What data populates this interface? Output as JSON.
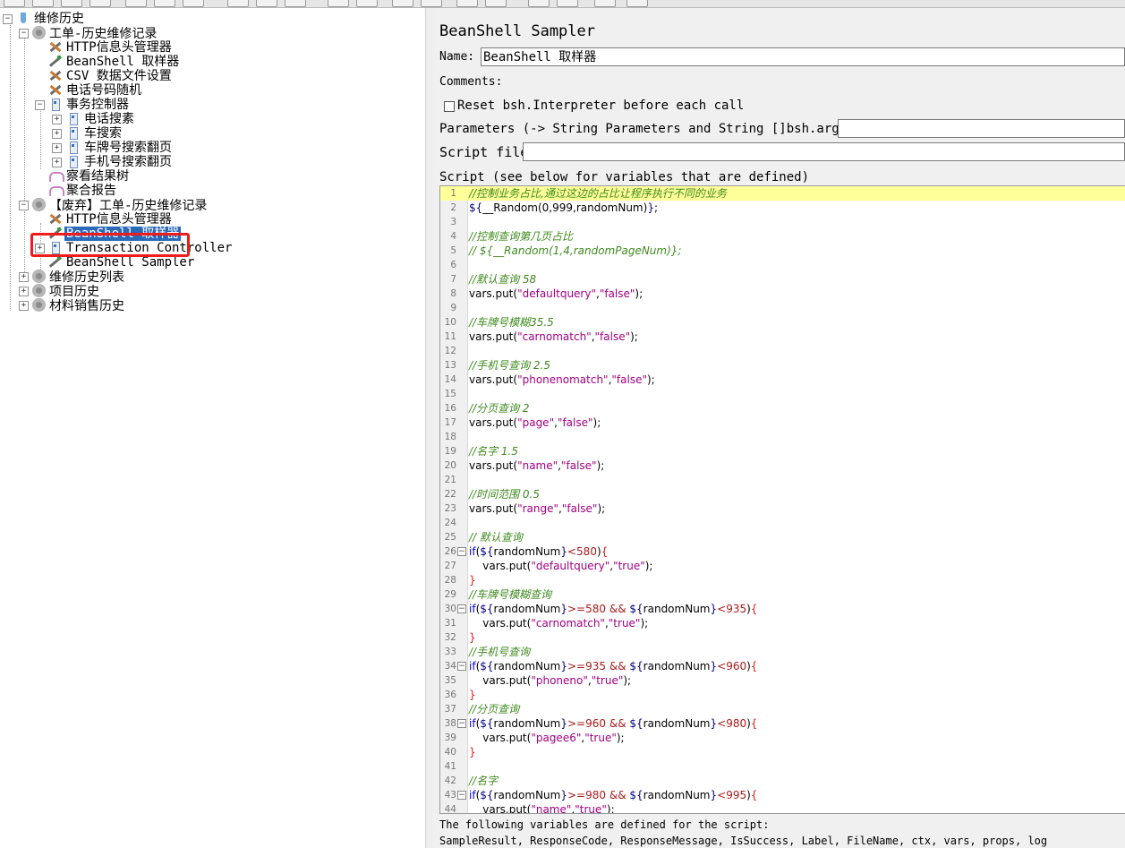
{
  "tree": {
    "items": [
      {
        "label": "维修历史",
        "icon": "flask-icon",
        "expander": "−"
      },
      {
        "label": "工单-历史维修记录",
        "icon": "gear-icon",
        "expander": "−"
      },
      {
        "label": "HTTP信息头管理器",
        "icon": "wrench-icon"
      },
      {
        "label": "BeanShell 取样器",
        "icon": "pen-icon"
      },
      {
        "label": "CSV 数据文件设置",
        "icon": "wrench-icon"
      },
      {
        "label": "电话号码随机",
        "icon": "wrench-icon"
      },
      {
        "label": "事务控制器",
        "icon": "controller-icon",
        "expander": "−"
      },
      {
        "label": "电话搜素",
        "icon": "controller-icon",
        "expander": "+"
      },
      {
        "label": "车搜索",
        "icon": "controller-icon",
        "expander": "+"
      },
      {
        "label": "车牌号搜索翻页",
        "icon": "controller-icon",
        "expander": "+"
      },
      {
        "label": "手机号搜索翻页",
        "icon": "controller-icon",
        "expander": "+"
      },
      {
        "label": "察看结果树",
        "icon": "listener-icon"
      },
      {
        "label": "聚合报告",
        "icon": "listener-icon"
      },
      {
        "label": "【废弃】工单-历史维修记录",
        "icon": "gear-icon",
        "expander": "−"
      },
      {
        "label": "HTTP信息头管理器",
        "icon": "wrench-icon"
      },
      {
        "label": "BeanShell 取样器",
        "icon": "pen-icon",
        "selected": true
      },
      {
        "label": "Transaction Controller",
        "icon": "controller-icon",
        "expander": "+"
      },
      {
        "label": "BeanShell Sampler",
        "icon": "pen-icon"
      },
      {
        "label": "维修历史列表",
        "icon": "gear-icon",
        "expander": "+"
      },
      {
        "label": "项目历史",
        "icon": "gear-icon",
        "expander": "+"
      },
      {
        "label": "材料销售历史",
        "icon": "gear-icon",
        "expander": "+"
      }
    ]
  },
  "panel": {
    "title": "BeanShell Sampler",
    "name_label": "Name:",
    "name_value": "BeanShell 取样器",
    "comments_label": "Comments:",
    "comments_value": "",
    "reset_label": "Reset bsh.Interpreter before each call",
    "reset_checked": false,
    "params_label": "Parameters (-> String Parameters and String []bsh.args)",
    "params_value": "",
    "script_file_label": "Script file",
    "script_file_value": "",
    "script_label": "Script (see below for variables that are defined)",
    "footer_line1": "The following variables are defined for the script:",
    "footer_line2": "SampleResult, ResponseCode, ResponseMessage, IsSuccess, Label, FileName, ctx, vars, props, log"
  },
  "script_lines": [
    "//控制业务占比,通过这边的占比让程序执行不同的业务",
    "${__Random(0,999,randomNum)};",
    "",
    "//控制查询第几页占比",
    "// ${__Random(1,4,randomPageNum)};",
    "",
    "//默认查询 58",
    "vars.put(\"defaultquery\",\"false\");",
    "",
    "//车牌号模糊35.5",
    "vars.put(\"carnomatch\",\"false\");",
    "",
    "//手机号查询 2.5",
    "vars.put(\"phonenomatch\",\"false\");",
    "",
    "//分页查询 2",
    "vars.put(\"page\",\"false\");",
    "",
    "//名字 1.5",
    "vars.put(\"name\",\"false\");",
    "",
    "//时间范围 0.5",
    "vars.put(\"range\",\"false\");",
    "",
    "// 默认查询",
    "if(${randomNum}<580){",
    "    vars.put(\"defaultquery\",\"true\");",
    "}",
    "//车牌号模糊查询",
    "if(${randomNum}>=580 && ${randomNum}<935){",
    "    vars.put(\"carnomatch\",\"true\");",
    "}",
    "//手机号查询",
    "if(${randomNum}>=935 && ${randomNum}<960){",
    "    vars.put(\"phoneno\",\"true\");",
    "}",
    "//分页查询",
    "if(${randomNum}>=960 && ${randomNum}<980){",
    "    vars.put(\"pagee6\",\"true\");",
    "}",
    "",
    "//名字",
    "if(${randomNum}>=980 && ${randomNum}<995){",
    "    vars.put(\"name\",\"true\");"
  ],
  "colors": {
    "selection": "#2a6ab9",
    "highlight_box": "#ee1c1c",
    "current_line": "#ffff9a",
    "comment": "#3f8a1f",
    "keyword": "#0000dd",
    "string": "#a00080"
  }
}
